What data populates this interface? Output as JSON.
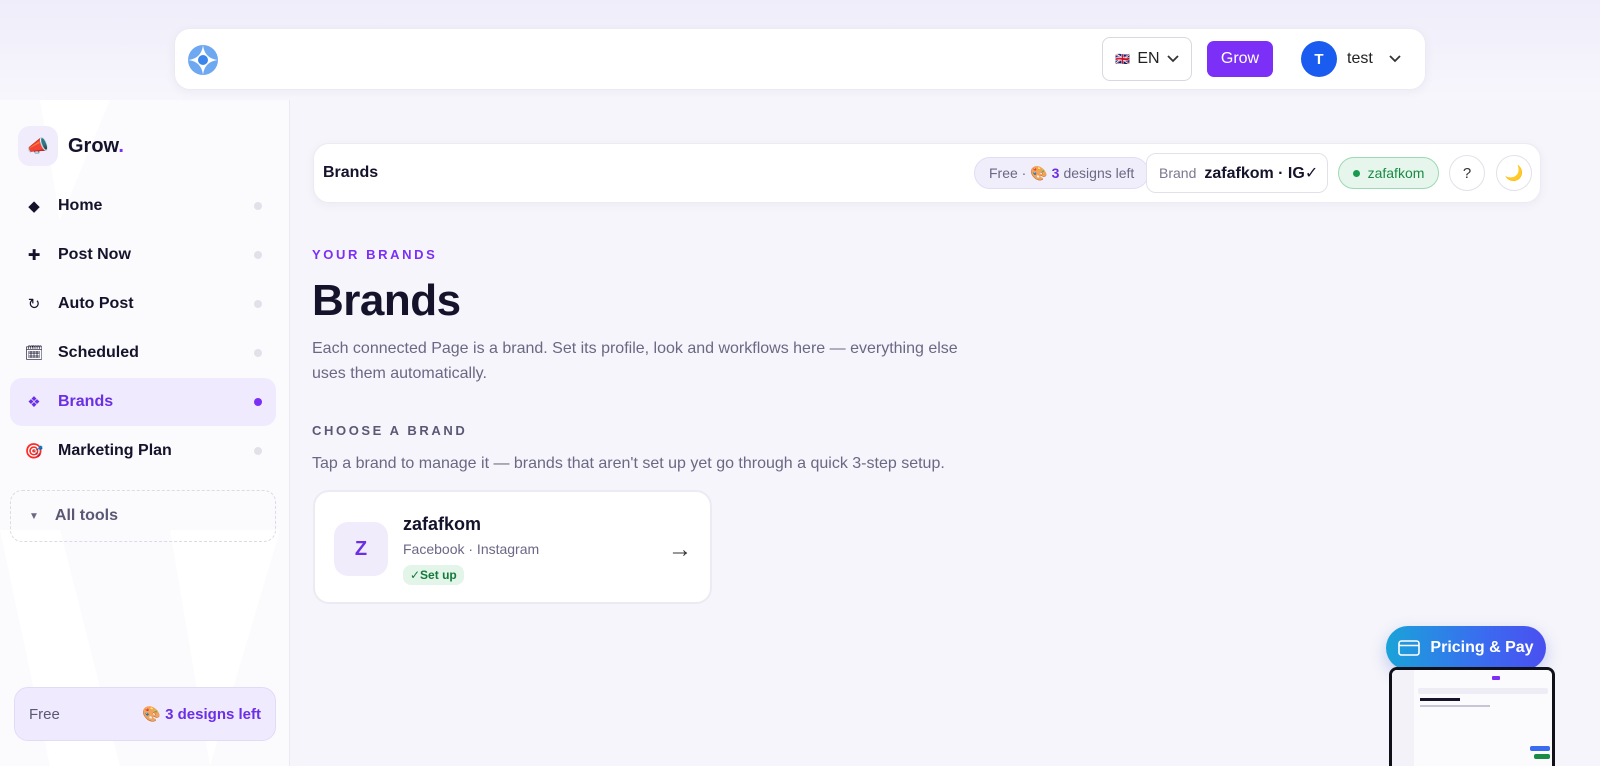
{
  "topbar": {
    "language": "EN",
    "language_flag": "🇬🇧",
    "grow_label": "Grow",
    "user_initial": "T",
    "user_name": "test"
  },
  "sidebar": {
    "brand_name": "Grow",
    "brand_dot": ".",
    "brand_icon": "📣",
    "items": [
      {
        "label": "Home",
        "icon": "◆",
        "icon_name": "home-icon",
        "active": false
      },
      {
        "label": "Post Now",
        "icon": "✚",
        "icon_name": "plus-icon",
        "active": false
      },
      {
        "label": "Auto Post",
        "icon": "↻",
        "icon_name": "refresh-icon",
        "active": false
      },
      {
        "label": "Scheduled",
        "icon": "🗓",
        "icon_name": "calendar-icon",
        "active": false
      },
      {
        "label": "Brands",
        "icon": "❖",
        "icon_name": "brands-icon",
        "active": true
      },
      {
        "label": "Marketing Plan",
        "icon": "🎯",
        "icon_name": "target-icon",
        "active": false
      }
    ],
    "all_tools_label": "All tools",
    "plan": {
      "tier": "Free",
      "designs": "🎨 3 designs left"
    }
  },
  "header": {
    "title": "Brands",
    "plan_pill": {
      "tier": "Free · 🎨",
      "count": "3",
      "suffix": "designs left"
    },
    "brand_select": {
      "label": "Brand",
      "value": "zafafkom · IG✓"
    },
    "status": "zafafkom",
    "help": "?",
    "theme": "🌙"
  },
  "main": {
    "eyebrow": "YOUR BRANDS",
    "title": "Brands",
    "description": "Each connected Page is a brand. Set its profile, look and workflows here — everything else uses them automatically.",
    "choose_eyebrow": "CHOOSE A BRAND",
    "choose_description": "Tap a brand to manage it — brands that aren't set up yet go through a quick 3-step setup.",
    "brands": [
      {
        "initial": "Z",
        "name": "zafafkom",
        "platforms": "Facebook · Instagram",
        "status": "✓Set up"
      }
    ]
  },
  "floating": {
    "pricing_label": "Pricing & Pay"
  },
  "colors": {
    "accent": "#7b2ff7",
    "active_bg": "#efeafd",
    "success": "#1a8a45"
  }
}
